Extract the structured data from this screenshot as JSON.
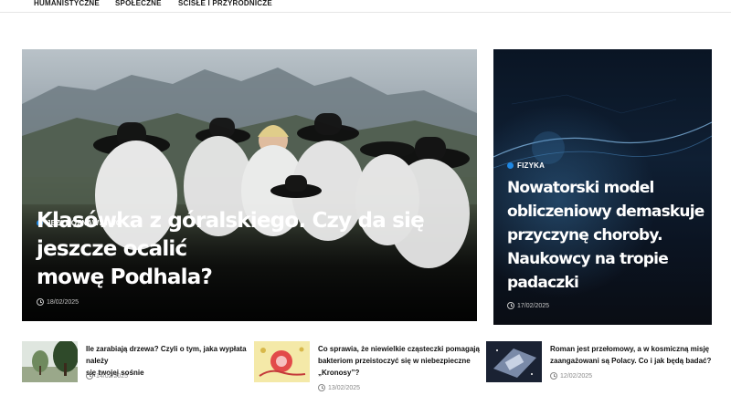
{
  "nav": {
    "items": [
      "HUMANISTYCZNE",
      "SPOŁECZNE",
      "ŚCISŁE I PRZYRODNICZE"
    ]
  },
  "hero_main": {
    "category": "JĘZYKOZNAWSTWO",
    "title_line1": "Klasówka z góralskiego. Czy da się jeszcze ocalić",
    "title_line2": "mowę Podhala?",
    "date": "18/02/2025"
  },
  "hero_side": {
    "category": "FIZYKA",
    "title_lines": [
      "Nowatorski model",
      "obliczeniowy demaskuje",
      "przyczynę choroby.",
      "Naukowcy na tropie",
      "padaczki"
    ],
    "date": "17/02/2025"
  },
  "small_articles": [
    {
      "title_lines": [
        "Ile zarabiają drzewa? Czyli o tym, jaka wypłata należy",
        "się twojej sośnie"
      ],
      "date": "14/02/2025"
    },
    {
      "title_lines": [
        "Co sprawia, że niewielkie cząsteczki pomagają",
        "bakteriom przeistoczyć się w niebezpieczne",
        "„Kronosy”?"
      ],
      "date": "13/02/2025"
    },
    {
      "title_lines": [
        "Roman jest przełomowy, a w kosmiczną misję",
        "zaangażowani są Polacy. Co i jak będą badać?"
      ],
      "date": "12/02/2025"
    }
  ],
  "colors": {
    "accent": "#1e88e5",
    "text": "#111111",
    "muted": "#888888"
  }
}
